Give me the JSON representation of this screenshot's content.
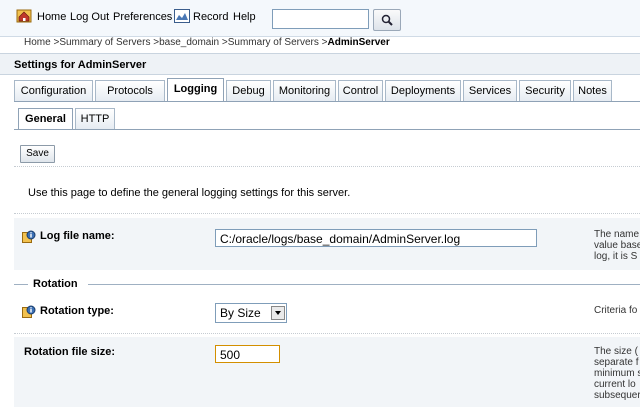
{
  "toolbar": {
    "home": "Home",
    "logout": "Log Out",
    "preferences": "Preferences",
    "record": "Record",
    "help": "Help",
    "search_value": ""
  },
  "breadcrumb": {
    "items": [
      "Home",
      "Summary of Servers",
      "base_domain",
      "Summary of Servers"
    ],
    "current": "AdminServer"
  },
  "settings_title": "Settings for AdminServer",
  "tabs": [
    "Configuration",
    "Protocols",
    "Logging",
    "Debug",
    "Monitoring",
    "Control",
    "Deployments",
    "Services",
    "Security",
    "Notes"
  ],
  "active_tab": "Logging",
  "subtabs": [
    "General",
    "HTTP"
  ],
  "active_subtab": "General",
  "save_label": "Save",
  "description": "Use this page to define the general logging settings for this server.",
  "fields": {
    "log_file_name": {
      "label": "Log file name:",
      "value": "C:/oracle/logs/base_domain/AdminServer.log",
      "help": [
        "The name",
        "value base",
        "log, it is S"
      ]
    },
    "rotation_section": "Rotation",
    "rotation_type": {
      "label": "Rotation type:",
      "value": "By Size",
      "help": [
        "Criteria fo"
      ]
    },
    "rotation_file_size": {
      "label": "Rotation file size:",
      "value": "500",
      "help": [
        "The size (",
        "separate f",
        "minimum s",
        "current lo",
        "subsequer"
      ]
    }
  },
  "colors": {
    "toolbar_bg": "#f4f8fc",
    "header_bg": "#eef2f6",
    "row_bg": "#f2f5f8",
    "focus_border": "#d38f00"
  }
}
